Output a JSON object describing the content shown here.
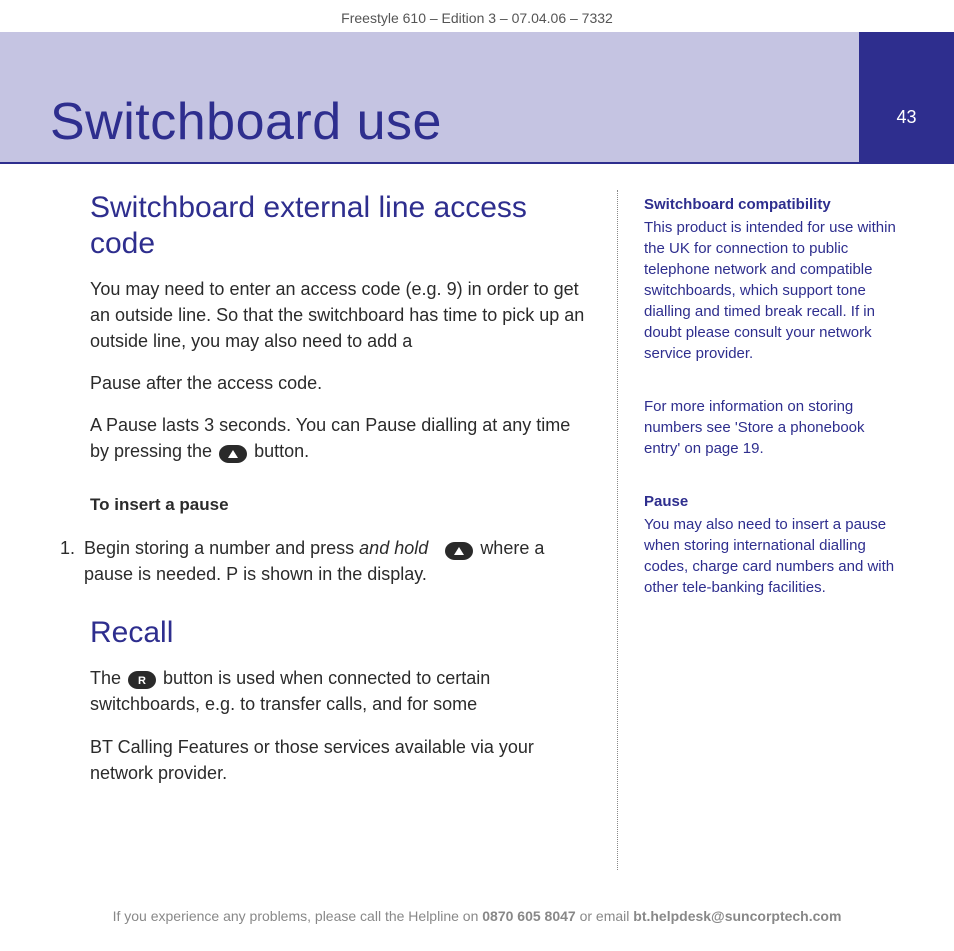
{
  "meta": {
    "header_line": "Freestyle 610 – Edition 3 – 07.04.06 – 7332",
    "page_number": "43"
  },
  "banner": {
    "title": "Switchboard use"
  },
  "main": {
    "section1_title": "Switchboard external line access code",
    "p1": "You may need to enter an access code (e.g. 9) in order to get an outside line. So that the switchboard has time to pick up an outside line, you may also need to add a",
    "p2": "Pause after the access code.",
    "p3a": "A Pause lasts 3 seconds. You can Pause dialling at any time by pressing the ",
    "p3b": " button.",
    "sub1": "To insert a pause",
    "step1_num": "1.",
    "step1a": "Begin storing a number and press ",
    "step1_hold": "and hold",
    "step1b": " where a pause is needed. ",
    "step1_p": "P",
    "step1c": " is shown in the display.",
    "section2_title": "Recall",
    "p4a": "The ",
    "p4b": " button is used when connected to certain switchboards, e.g. to transfer calls, and for some",
    "p5": "BT Calling Features or those services available via your network provider."
  },
  "sidebar": {
    "b1_title": "Switchboard compatibility",
    "b1_body": "This product is intended for use within the UK for connection to public telephone network and compatible switchboards, which support tone dialling and timed break recall. If in doubt please consult your network service provider.",
    "b2_body": "For more information on storing numbers see 'Store a phonebook entry' on page 19.",
    "b3_title": "Pause",
    "b3_body": "You may also need to insert a pause when storing international dialling codes, charge card numbers and with other tele-banking facilities."
  },
  "footer": {
    "t1": "If you experience any problems, please call the Helpline on ",
    "phone": "0870 605 8047",
    "t2": " or email ",
    "email": "bt.helpdesk@suncorptech.com"
  }
}
